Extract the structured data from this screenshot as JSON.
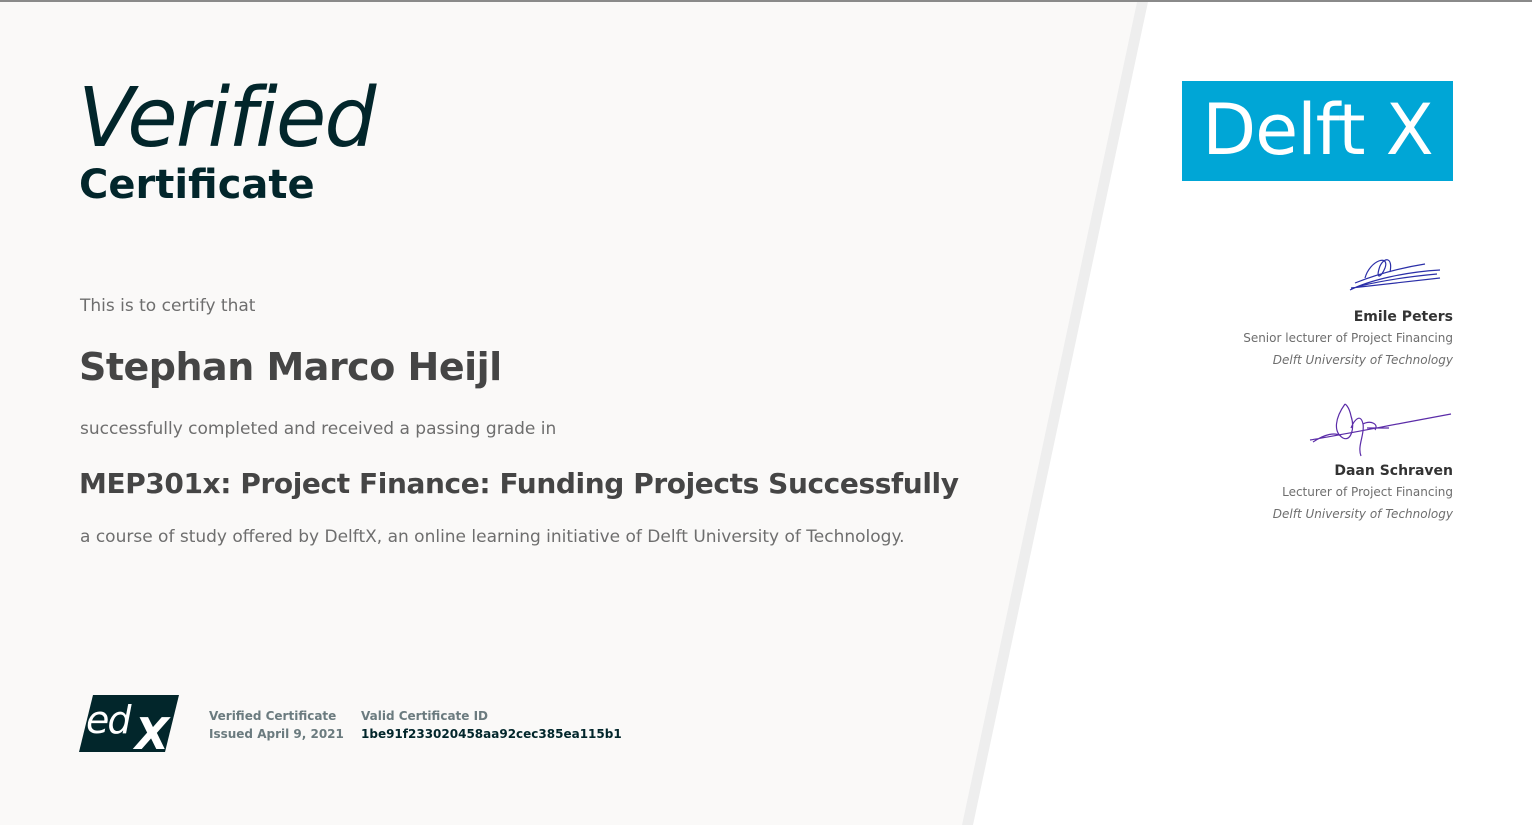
{
  "certificate": {
    "title_main": "Verified",
    "title_sub": "Certificate",
    "intro": "This is to certify that",
    "recipient": "Stephan Marco Heijl",
    "passing_text": "successfully completed and received a passing grade in",
    "course": "MEP301x: Project Finance: Funding Projects Successfully",
    "offered_text": "a course of study offered by DelftX, an online learning initiative of Delft University of Technology."
  },
  "footer": {
    "logo_text": "edX",
    "type_label": "Verified Certificate",
    "issued": "Issued April 9, 2021",
    "id_label": "Valid Certificate ID",
    "id_value": "1be91f233020458aa92cec385ea115b1"
  },
  "partner": {
    "logo_text": "Delft X"
  },
  "signatories": [
    {
      "name": "Emile Peters",
      "title": "Senior lecturer of Project Financing",
      "organization": "Delft University of Technology"
    },
    {
      "name": "Daan Schraven",
      "title": "Lecturer of Project Financing",
      "organization": "Delft University of Technology"
    }
  ],
  "colors": {
    "dark_teal": "#02262b",
    "partner_blue": "#00a6d6",
    "paper": "#faf9f8",
    "signature_ink": "#2b2fa8"
  }
}
